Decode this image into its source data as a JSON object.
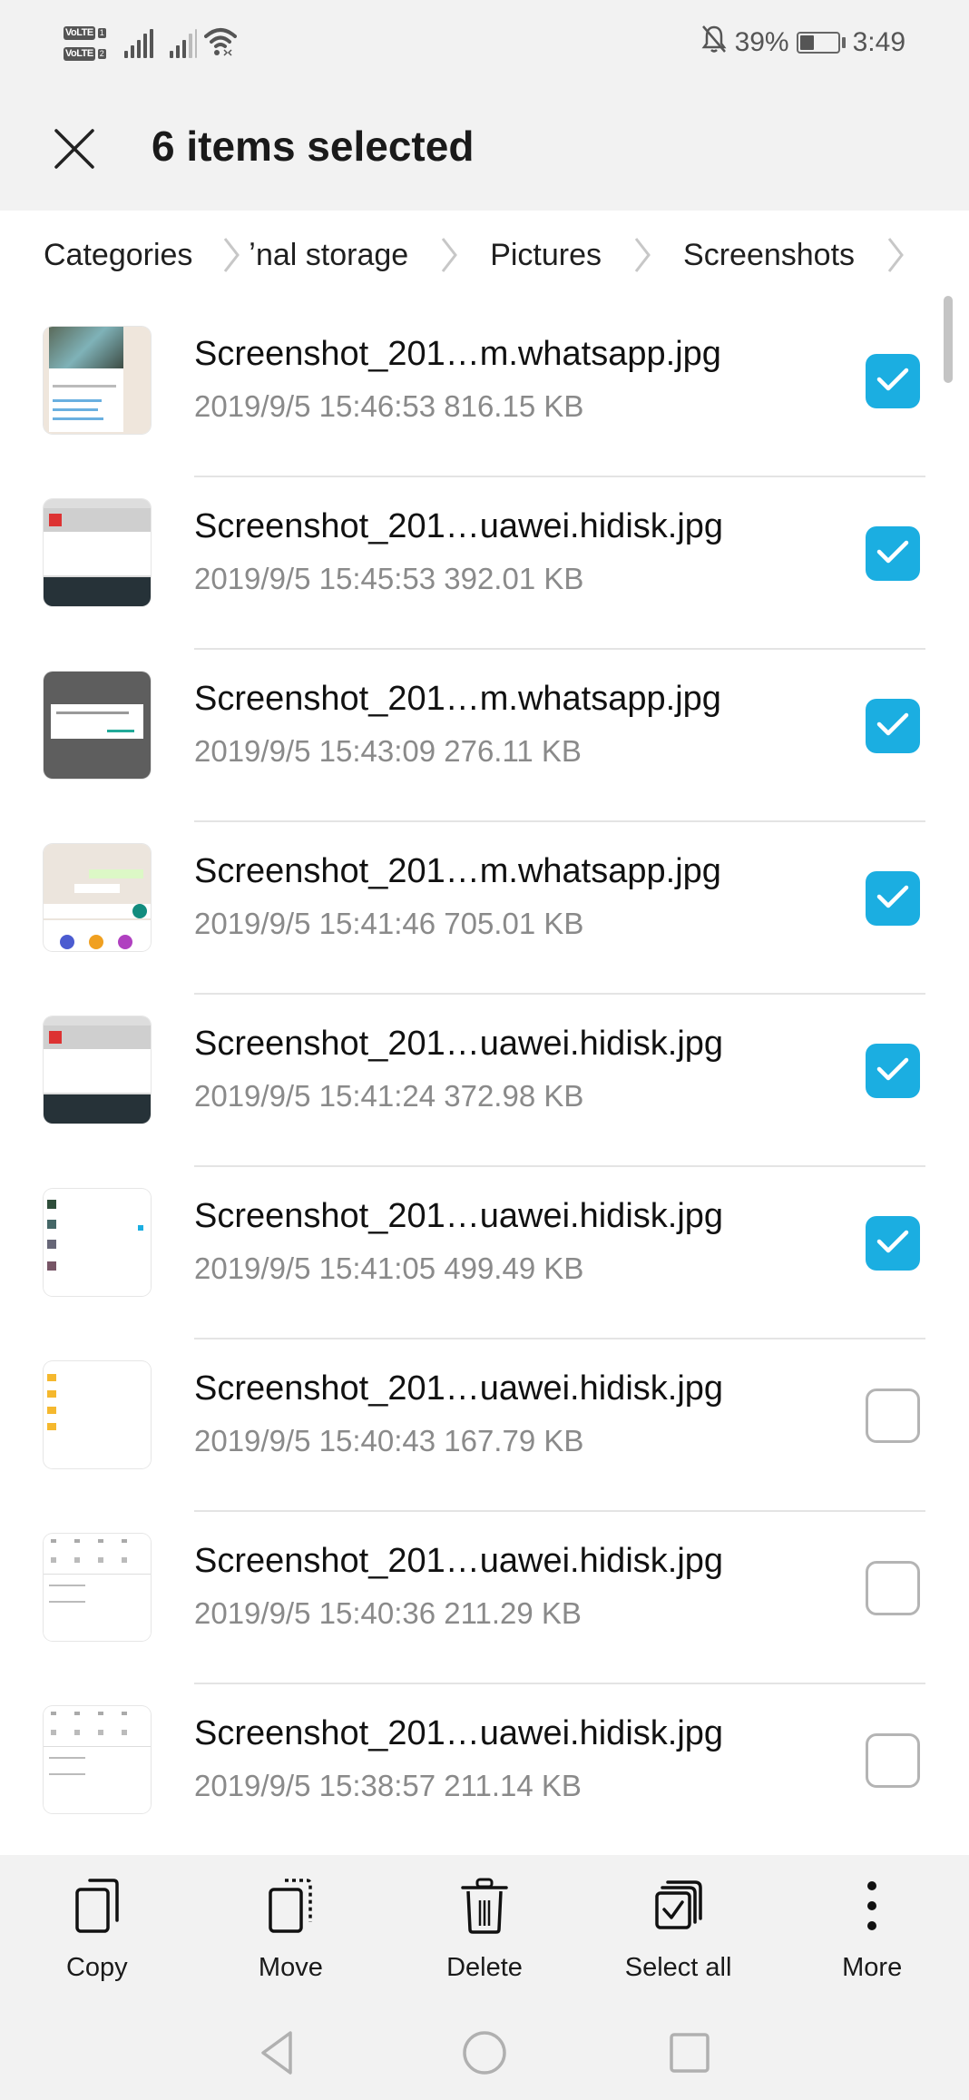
{
  "status_bar": {
    "sim1_label": "VoLTE",
    "sim1_num": "1",
    "sim2_label": "VoLTE",
    "sim2_num": "2",
    "battery_percent_text": "39%",
    "battery_level": 0.39,
    "time": "3:49",
    "icons": [
      "signal-sim1-icon",
      "signal-sim2-icon",
      "wifi-icon",
      "bell-muted-icon",
      "battery-icon"
    ]
  },
  "header": {
    "close_icon": "close-icon",
    "title": "6 items selected"
  },
  "breadcrumb": {
    "items": [
      "Categories",
      "ʼnal storage",
      "Pictures",
      "Screenshots"
    ]
  },
  "files": [
    {
      "name": "Screenshot_201…m.whatsapp.jpg",
      "meta": "2019/9/5 15:46:53 816.15 KB",
      "checked": true,
      "thumb": "whatsapp-light"
    },
    {
      "name": "Screenshot_201…uawei.hidisk.jpg",
      "meta": "2019/9/5 15:45:53 392.01 KB",
      "checked": true,
      "thumb": "dialog-dark-keyboard"
    },
    {
      "name": "Screenshot_201…m.whatsapp.jpg",
      "meta": "2019/9/5 15:43:09 276.11 KB",
      "checked": true,
      "thumb": "dark-dialog"
    },
    {
      "name": "Screenshot_201…m.whatsapp.jpg",
      "meta": "2019/9/5 15:41:46 705.01 KB",
      "checked": true,
      "thumb": "chat-share"
    },
    {
      "name": "Screenshot_201…uawei.hidisk.jpg",
      "meta": "2019/9/5 15:41:24 372.98 KB",
      "checked": true,
      "thumb": "dialog-dark-keyboard"
    },
    {
      "name": "Screenshot_201…uawei.hidisk.jpg",
      "meta": "2019/9/5 15:41:05 499.49 KB",
      "checked": true,
      "thumb": "list-light"
    },
    {
      "name": "Screenshot_201…uawei.hidisk.jpg",
      "meta": "2019/9/5 15:40:43 167.79 KB",
      "checked": false,
      "thumb": "folders"
    },
    {
      "name": "Screenshot_201…uawei.hidisk.jpg",
      "meta": "2019/9/5 15:40:36 211.29 KB",
      "checked": false,
      "thumb": "grid-icons"
    },
    {
      "name": "Screenshot_201…uawei.hidisk.jpg",
      "meta": "2019/9/5 15:38:57 211.14 KB",
      "checked": false,
      "thumb": "grid-icons"
    }
  ],
  "toolbar": {
    "copy_label": "Copy",
    "move_label": "Move",
    "delete_label": "Delete",
    "select_all_label": "Select all",
    "more_label": "More"
  },
  "navbar": {
    "icons": [
      "back-icon",
      "home-icon",
      "recents-icon"
    ]
  },
  "colors": {
    "accent": "#1baee1",
    "bar_bg": "#f2f2f2",
    "meta_text": "#8a8a8a"
  }
}
